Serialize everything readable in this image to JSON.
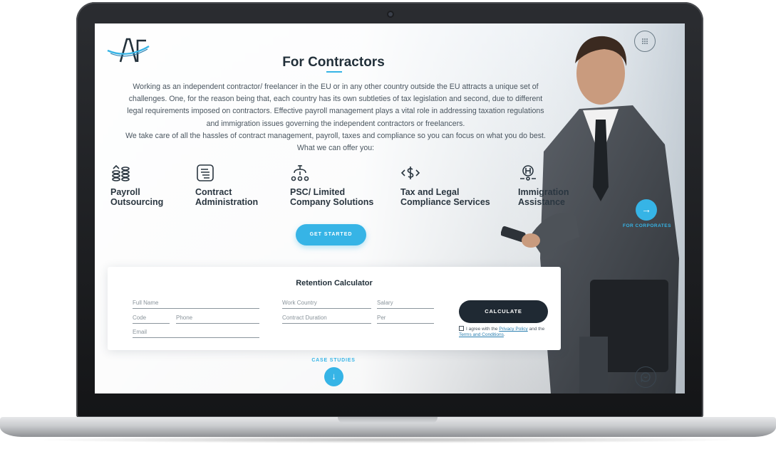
{
  "brand": {
    "logo_text": "AF"
  },
  "header": {
    "title": "For Contractors"
  },
  "intro": {
    "lines": [
      "Working as an independent contractor/ freelancer in the EU or in any other country outside the EU attracts a unique set of",
      "challenges. One, for the reason being that, each country has its own subtleties of tax legislation and second, due to different",
      "legal requirements imposed on contractors. Effective payroll management plays a vital role in addressing taxation regulations",
      "and immigration issues governing the independent contractors or freelancers.",
      "We take care of all the hassles of contract management, payroll, taxes and compliance so you can focus on what you do best.",
      "What we can offer you:"
    ]
  },
  "services": [
    {
      "label": "Payroll\nOutsourcing",
      "icon": "coins-stack-icon"
    },
    {
      "label": "Contract\nAdministration",
      "icon": "document-icon"
    },
    {
      "label": "PSC/ Limited\nCompany Solutions",
      "icon": "company-network-icon"
    },
    {
      "label": "Tax and Legal\nCompliance Services",
      "icon": "dollar-code-icon"
    },
    {
      "label": "Immigration\nAssistance",
      "icon": "passport-icon"
    }
  ],
  "cta": {
    "get_started": "GET STARTED"
  },
  "side_nav": {
    "label": "FOR CORPORATES"
  },
  "calculator": {
    "title": "Retention Calculator",
    "fields": {
      "full_name": "Full Name",
      "code": "Code",
      "phone": "Phone",
      "email": "Email",
      "work_country": "Work Country",
      "salary": "Salary",
      "contract_duration": "Contract Duration",
      "per": "Per"
    },
    "button": "CALCULATE",
    "agree": {
      "prefix": "I agree with the ",
      "privacy": "Privacy Policy",
      "middle": " and the ",
      "terms": "Terms and Conditions",
      "suffix": "."
    }
  },
  "case_studies": {
    "label": "CASE STUDIES"
  },
  "colors": {
    "accent": "#36b4e6",
    "dark": "#1f2933",
    "text": "#4a5660"
  }
}
